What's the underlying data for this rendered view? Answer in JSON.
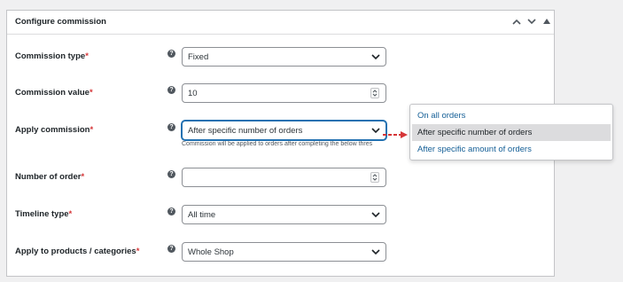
{
  "panel": {
    "title": "Configure commission",
    "controls": [
      "chevron-up-icon",
      "chevron-down-icon",
      "triangle-up-icon"
    ]
  },
  "fields": [
    {
      "label": "Commission type",
      "required": "*",
      "value": "Fixed",
      "kind": "select"
    },
    {
      "label": "Commission value",
      "required": "*",
      "value": "10",
      "kind": "number"
    },
    {
      "label": "Apply commission",
      "required": "*",
      "value": "After specific number of orders",
      "kind": "select"
    },
    {
      "label": "Number of order",
      "required": "*",
      "value": "",
      "kind": "number"
    },
    {
      "label": "Timeline type",
      "required": "*",
      "value": "All time",
      "kind": "select"
    },
    {
      "label": "Apply to products / categories",
      "required": "*",
      "value": "Whole Shop",
      "kind": "select"
    }
  ],
  "apply_commission_description": "Commission will be applied to orders after completing the below thres",
  "help_icon": "?",
  "dropdown": {
    "options": [
      "On all orders",
      "After specific number of orders",
      "After specific amount of orders"
    ],
    "selected_index": 1
  },
  "colors": {
    "required": "#d63638",
    "focus": "#2271b1",
    "link": "#135e96",
    "arrow": "#d63638"
  }
}
